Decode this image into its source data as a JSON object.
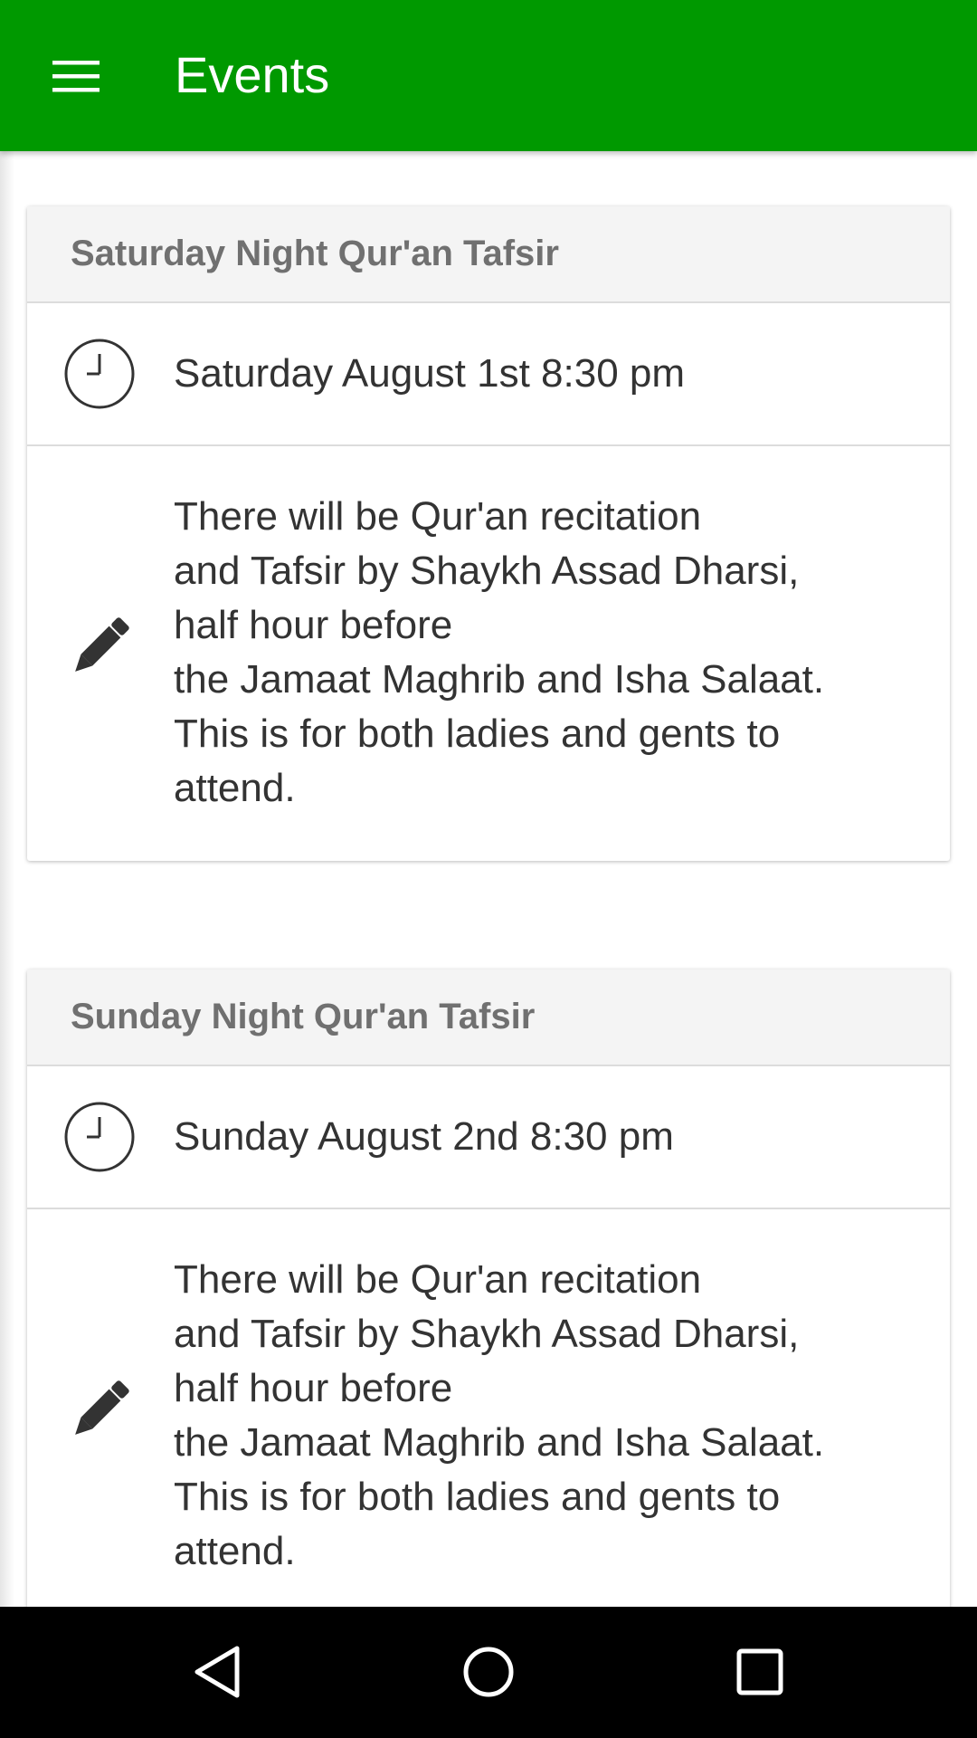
{
  "app_bar": {
    "title": "Events",
    "background": "#009900",
    "menu_icon": "hamburger-menu-icon"
  },
  "events": [
    {
      "title": "Saturday Night Qur'an Tafsir",
      "time": "Saturday August 1st 8:30 pm",
      "description": "There will be Qur'an recitation\nand Tafsir by Shaykh Assad Dharsi,\nhalf hour before\nthe Jamaat Maghrib and Isha Salaat.\nThis is for both ladies and gents to\nattend.",
      "time_icon": "clock-icon",
      "description_icon": "pencil-icon"
    },
    {
      "title": "Sunday Night Qur'an Tafsir",
      "time": "Sunday August 2nd 8:30 pm",
      "description": "There will be Qur'an recitation\nand Tafsir by Shaykh Assad Dharsi,\nhalf hour before\nthe Jamaat Maghrib and Isha Salaat.\nThis is for both ladies and gents to\nattend.",
      "time_icon": "clock-icon",
      "description_icon": "pencil-icon"
    }
  ],
  "nav_bar": {
    "back_icon": "back-triangle-icon",
    "home_icon": "home-circle-icon",
    "recents_icon": "recents-square-icon"
  }
}
